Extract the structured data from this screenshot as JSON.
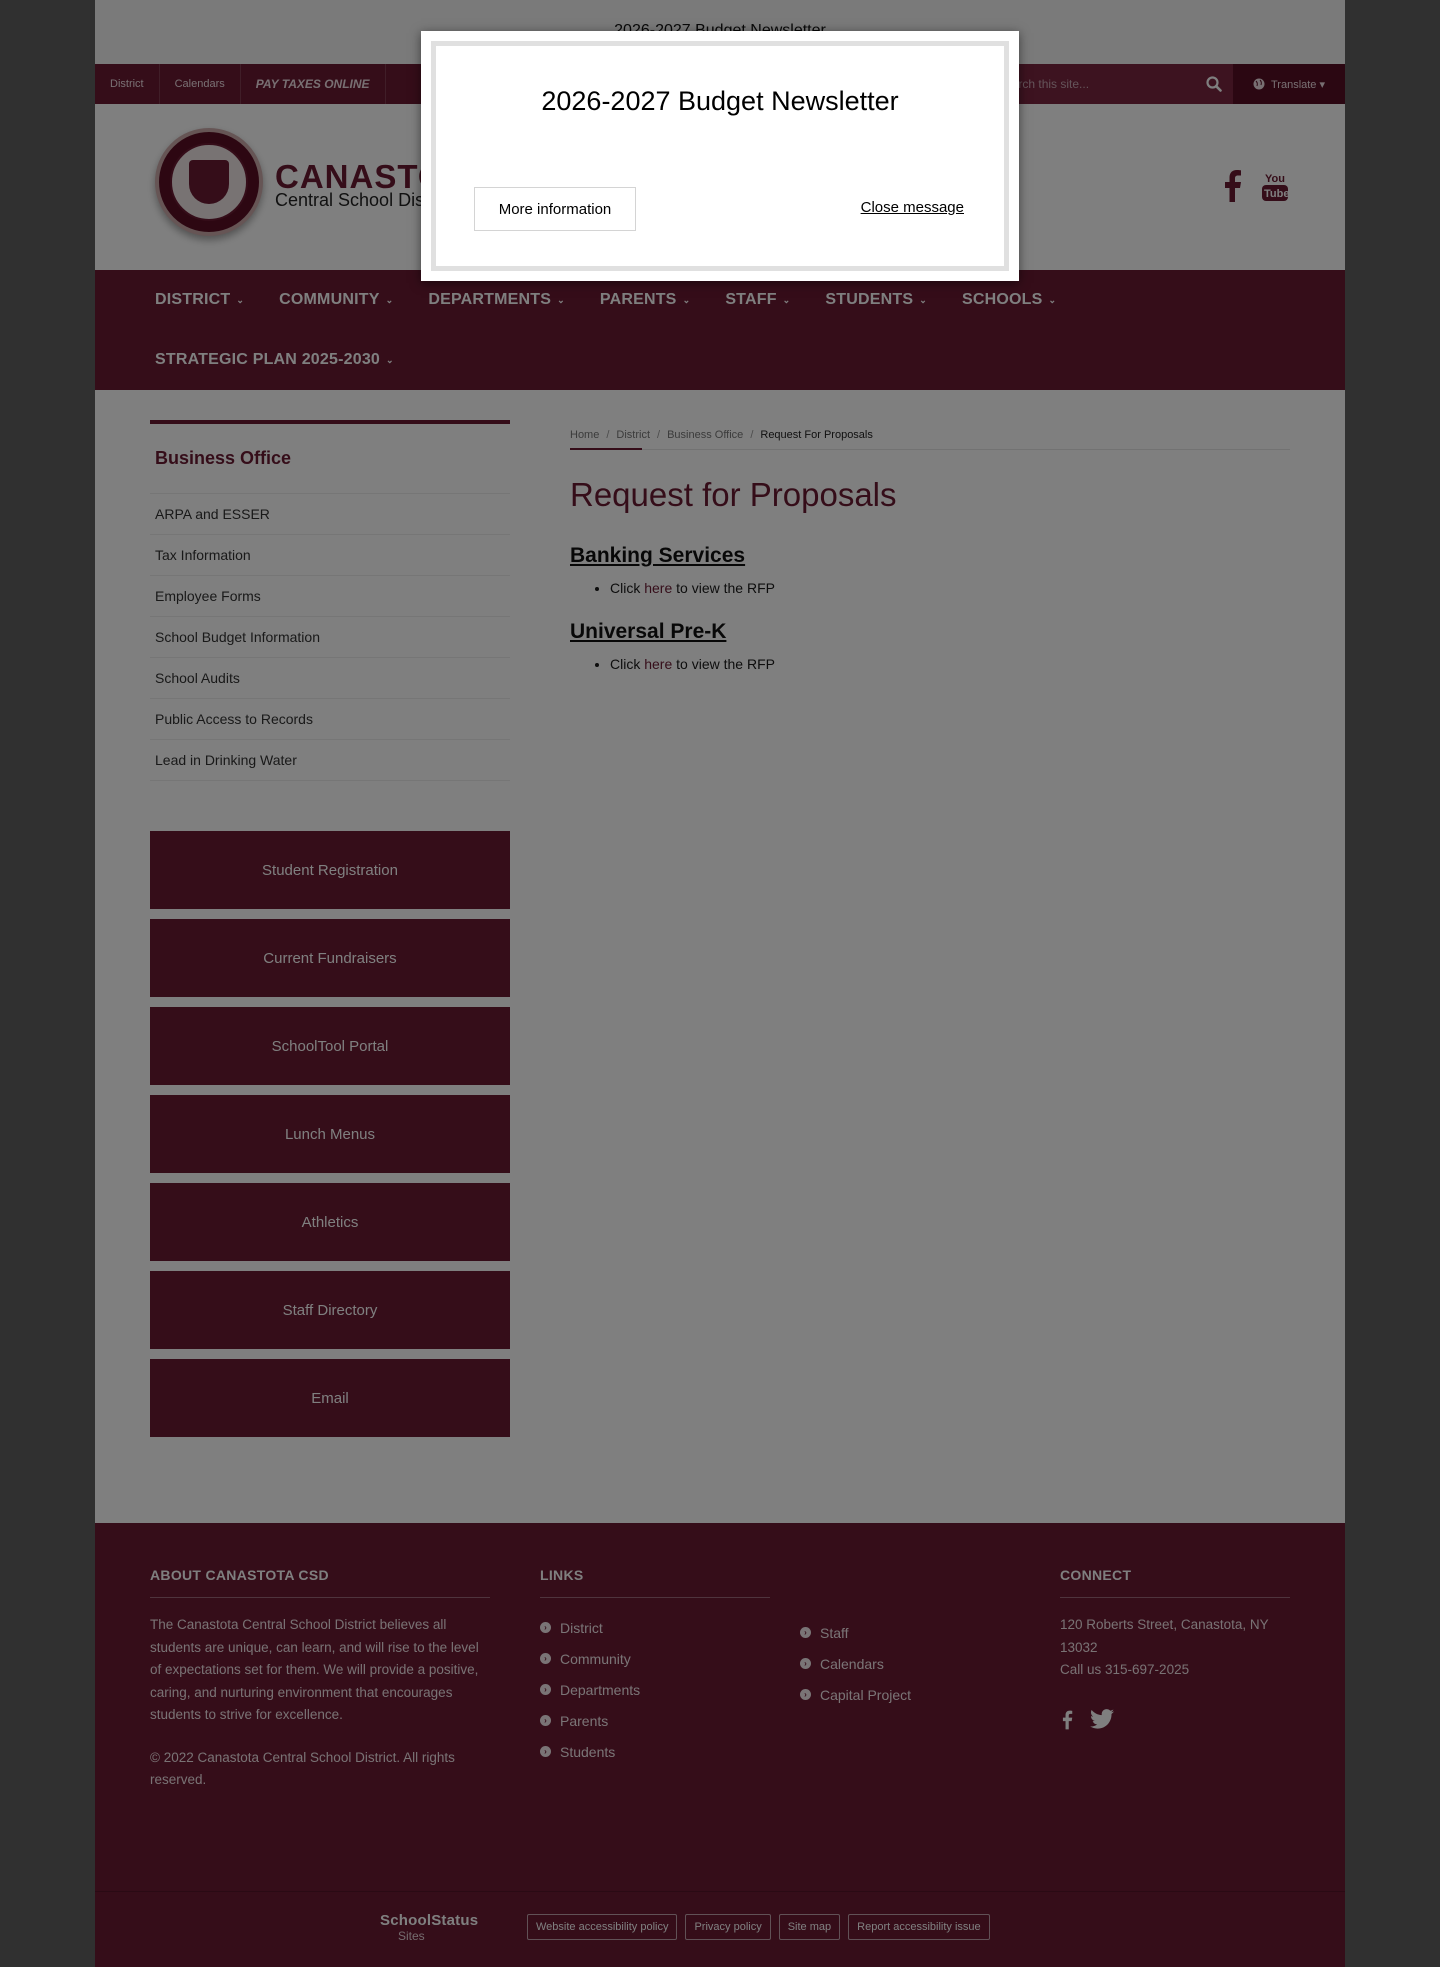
{
  "announcement": {
    "text": "2026-2027 Budget Newsletter"
  },
  "utility_bar": {
    "links": [
      "District",
      "Calendars",
      "PAY TAXES ONLINE"
    ],
    "search_placeholder": "Search this site...",
    "translate_label": "Translate ▾"
  },
  "brand": {
    "title": "CANASTOTA",
    "subtitle": "Central School District"
  },
  "main_nav": {
    "items": [
      "DISTRICT",
      "COMMUNITY",
      "DEPARTMENTS",
      "PARENTS",
      "STAFF",
      "STUDENTS",
      "SCHOOLS",
      "STRATEGIC PLAN 2025-2030"
    ]
  },
  "sidebar": {
    "heading": "Business Office",
    "items": [
      "ARPA and ESSER",
      "Tax Information",
      "Employee Forms",
      "School Budget Information",
      "School Audits",
      "Public Access to Records",
      "Lead in Drinking Water"
    ],
    "quick_links": [
      "Student Registration",
      "Current Fundraisers",
      "SchoolTool Portal",
      "Lunch Menus",
      "Athletics",
      "Staff Directory",
      "Email"
    ]
  },
  "breadcrumb": {
    "items": [
      "Home",
      "District",
      "Business Office"
    ],
    "current": "Request For Proposals"
  },
  "main": {
    "title": "Request for Proposals",
    "sections": [
      {
        "heading": "Banking Services",
        "pre": "Click ",
        "link": "here",
        "post": " to view the RFP"
      },
      {
        "heading": "Universal Pre-K",
        "pre": "Click ",
        "link": "here",
        "post": " to view the RFP"
      }
    ]
  },
  "footer": {
    "about_heading": "ABOUT CANASTOTA CSD",
    "about_text": "The Canastota Central School District believes all students are unique, can learn, and will rise to the level of expectations set for them. We will provide a positive, caring, and nurturing environment that encourages students to strive for excellence.",
    "copyright": "© 2022 Canastota Central School District. All rights reserved.",
    "links_heading": "LINKS",
    "links_col1": [
      "District",
      "Community",
      "Departments",
      "Parents",
      "Students"
    ],
    "links_col2": [
      "Staff",
      "Calendars",
      "Capital Project"
    ],
    "connect_heading": "CONNECT",
    "address": "120 Roberts Street, Canastota, NY 13032",
    "phone": "Call us 315-697-2025"
  },
  "bottom_bar": {
    "logo_main": "SchoolStatus",
    "logo_sub": "Sites",
    "links": [
      "Website accessibility policy",
      "Privacy policy",
      "Site map",
      "Report accessibility issue"
    ]
  },
  "modal": {
    "title": "2026-2027 Budget Newsletter",
    "more_label": "More information",
    "close_label": "Close message"
  },
  "colors": {
    "brand": "#6a1a33",
    "overlay": "rgba(0,0,0,0.5)"
  }
}
